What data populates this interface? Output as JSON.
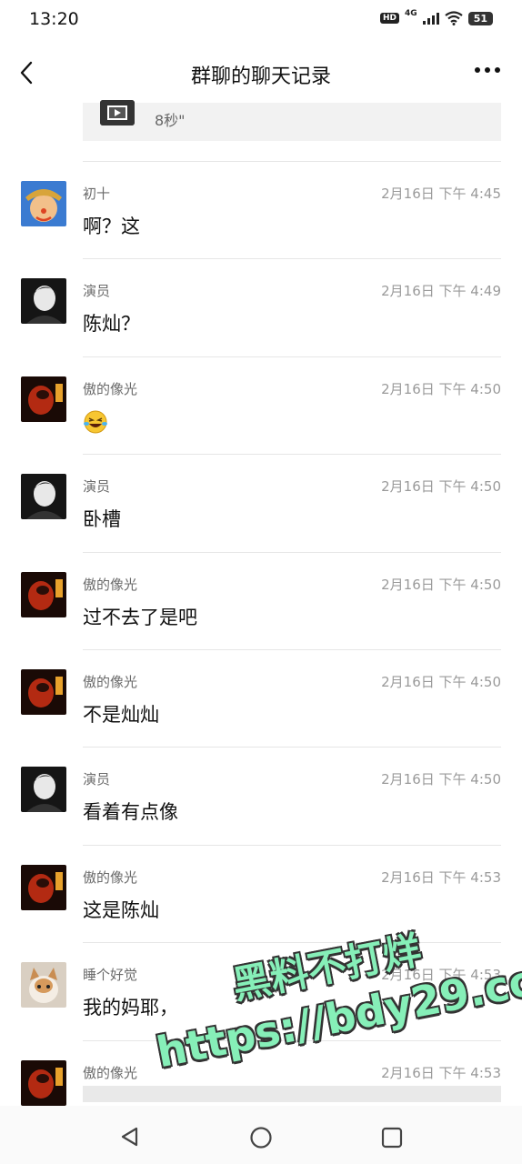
{
  "status_bar": {
    "time": "13:20",
    "hd": "HD",
    "network": "4G",
    "battery": "51"
  },
  "header": {
    "title": "群聊的聊天记录",
    "back_icon": "chevron-left-icon",
    "more_icon": "more-dots-icon"
  },
  "video_card": {
    "duration": "8秒\"",
    "icon": "video-icon"
  },
  "messages": [
    {
      "sender": "初十",
      "time": "2月16日 下午 4:45",
      "text": "啊？这",
      "avatar": "clown-avatar"
    },
    {
      "sender": "演员",
      "time": "2月16日 下午 4:49",
      "text": "陈灿？",
      "avatar": "dark-figure-avatar"
    },
    {
      "sender": "傲的像光",
      "time": "2月16日 下午 4:50",
      "text": "",
      "emoji": "laughing-tears-emoji",
      "avatar": "red-dark-avatar"
    },
    {
      "sender": "演员",
      "time": "2月16日 下午 4:50",
      "text": "卧槽",
      "avatar": "dark-figure-avatar"
    },
    {
      "sender": "傲的像光",
      "time": "2月16日 下午 4:50",
      "text": "过不去了是吧",
      "avatar": "red-dark-avatar"
    },
    {
      "sender": "傲的像光",
      "time": "2月16日 下午 4:50",
      "text": "不是灿灿",
      "avatar": "red-dark-avatar"
    },
    {
      "sender": "演员",
      "time": "2月16日 下午 4:50",
      "text": "看着有点像",
      "avatar": "dark-figure-avatar"
    },
    {
      "sender": "傲的像光",
      "time": "2月16日 下午 4:53",
      "text": "这是陈灿",
      "avatar": "red-dark-avatar"
    },
    {
      "sender": "睡个好觉",
      "time": "2月16日 下午 4:53",
      "text": "我的妈耶，",
      "avatar": "kitten-avatar"
    },
    {
      "sender": "傲的像光",
      "time": "2月16日 下午 4:53",
      "text": "",
      "avatar": "red-dark-avatar"
    }
  ],
  "watermark": {
    "line1": "黑料不打烊",
    "line2": "https://bdy29.co"
  },
  "bottom_nav": {
    "back_icon": "triangle-back-icon",
    "home_icon": "circle-home-icon",
    "recent_icon": "square-recent-icon"
  }
}
